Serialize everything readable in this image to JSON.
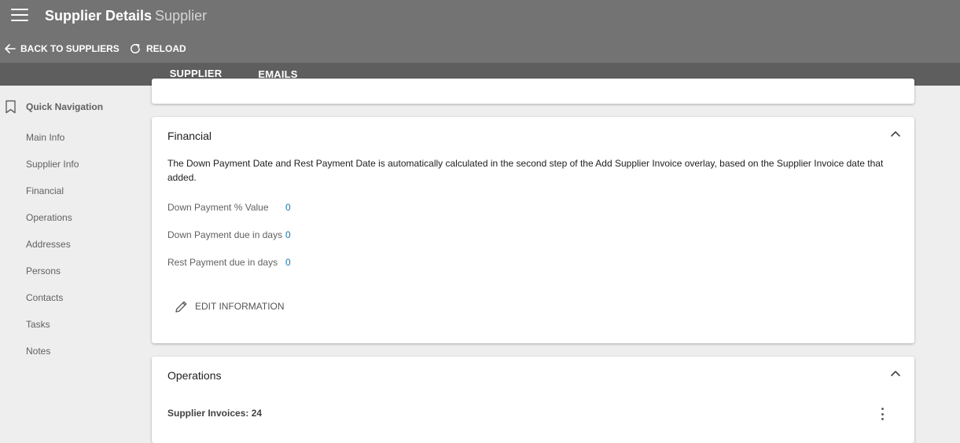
{
  "header": {
    "title": "Supplier Details",
    "subtitle": "Supplier",
    "back_label": "BACK TO SUPPLIERS",
    "reload_label": "RELOAD"
  },
  "tabs": [
    {
      "label": "SUPPLIER",
      "active": true
    },
    {
      "label": "EMAILS",
      "active": false
    }
  ],
  "sidebar": {
    "title": "Quick Navigation",
    "items": [
      {
        "label": "Main Info"
      },
      {
        "label": "Supplier Info"
      },
      {
        "label": "Financial"
      },
      {
        "label": "Operations"
      },
      {
        "label": "Addresses"
      },
      {
        "label": "Persons"
      },
      {
        "label": "Contacts"
      },
      {
        "label": "Tasks"
      },
      {
        "label": "Notes"
      }
    ]
  },
  "financial": {
    "title": "Financial",
    "description": "The Down Payment Date and Rest Payment Date is automatically calculated in the second step of the Add Supplier Invoice overlay, based on the Supplier Invoice date that added.",
    "fields": [
      {
        "label": "Down Payment % Value",
        "value": "0"
      },
      {
        "label": "Down Payment due in days",
        "value": "0"
      },
      {
        "label": "Rest Payment due in days",
        "value": "0"
      }
    ],
    "edit_label": "EDIT INFORMATION"
  },
  "operations": {
    "title": "Operations",
    "invoices_label": "Supplier Invoices: 24"
  },
  "colors": {
    "topbar": "#737373",
    "tabbar": "#5e5e5e",
    "link_value": "#1976a8"
  }
}
